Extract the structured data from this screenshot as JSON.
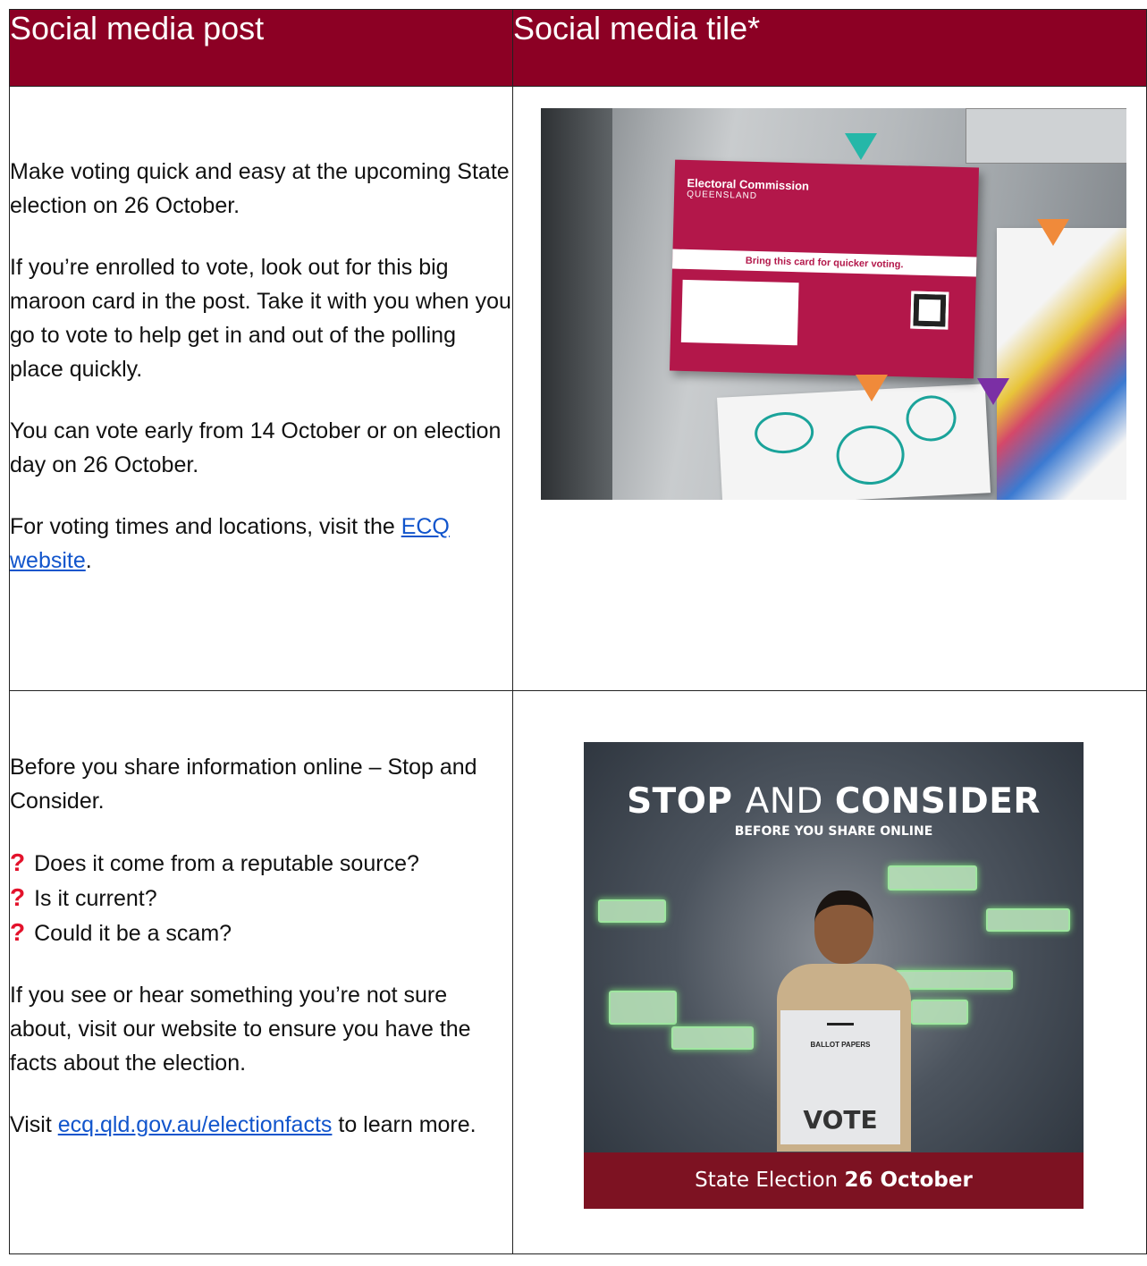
{
  "headers": {
    "post": "Social media post",
    "tile": "Social media tile*"
  },
  "row1": {
    "p1": "Make voting quick and easy at the upcoming State election on 26 October.",
    "p2": "If you’re enrolled to vote, look out for this big maroon card in the post. Take it with you when you go to vote to help get in and out of the polling place quickly.",
    "p3": "You can vote early from 14 October or on election day on 26 October.",
    "p4_text": "For voting times and locations, visit the ",
    "p4_link": "ECQ website",
    "p4_end": ".",
    "image": {
      "card_title": "Electoral Commission",
      "card_sub": "QUEENSLAND",
      "card_band": "Bring this card for quicker voting."
    }
  },
  "row2": {
    "p1": "Before you share information online – Stop and Consider.",
    "questions": [
      {
        "icon": "red-question-mark",
        "text": "Does it come from a reputable source?"
      },
      {
        "icon": "red-question-mark",
        "text": "Is it current?"
      },
      {
        "icon": "red-question-mark",
        "text": "Could it be a scam?"
      }
    ],
    "p2": "If you see or hear something you’re not sure about, visit our website to ensure you have the facts about the election.",
    "p3_text": "Visit ",
    "p3_link": "ecq.qld.gov.au/electionfacts",
    "p3_end": " to learn more.",
    "tile": {
      "title_a": "STOP ",
      "title_b": "AND ",
      "title_c": "CONSIDER",
      "subtitle": "BEFORE YOU SHARE ONLINE",
      "ballot_label": "BALLOT PAPERS",
      "box_label": "VOTE",
      "footer_a": "State Election ",
      "footer_b": "26 October"
    }
  },
  "colors": {
    "header_bg": "#8c0024",
    "link": "#1155cc",
    "question": "#e3122b"
  }
}
